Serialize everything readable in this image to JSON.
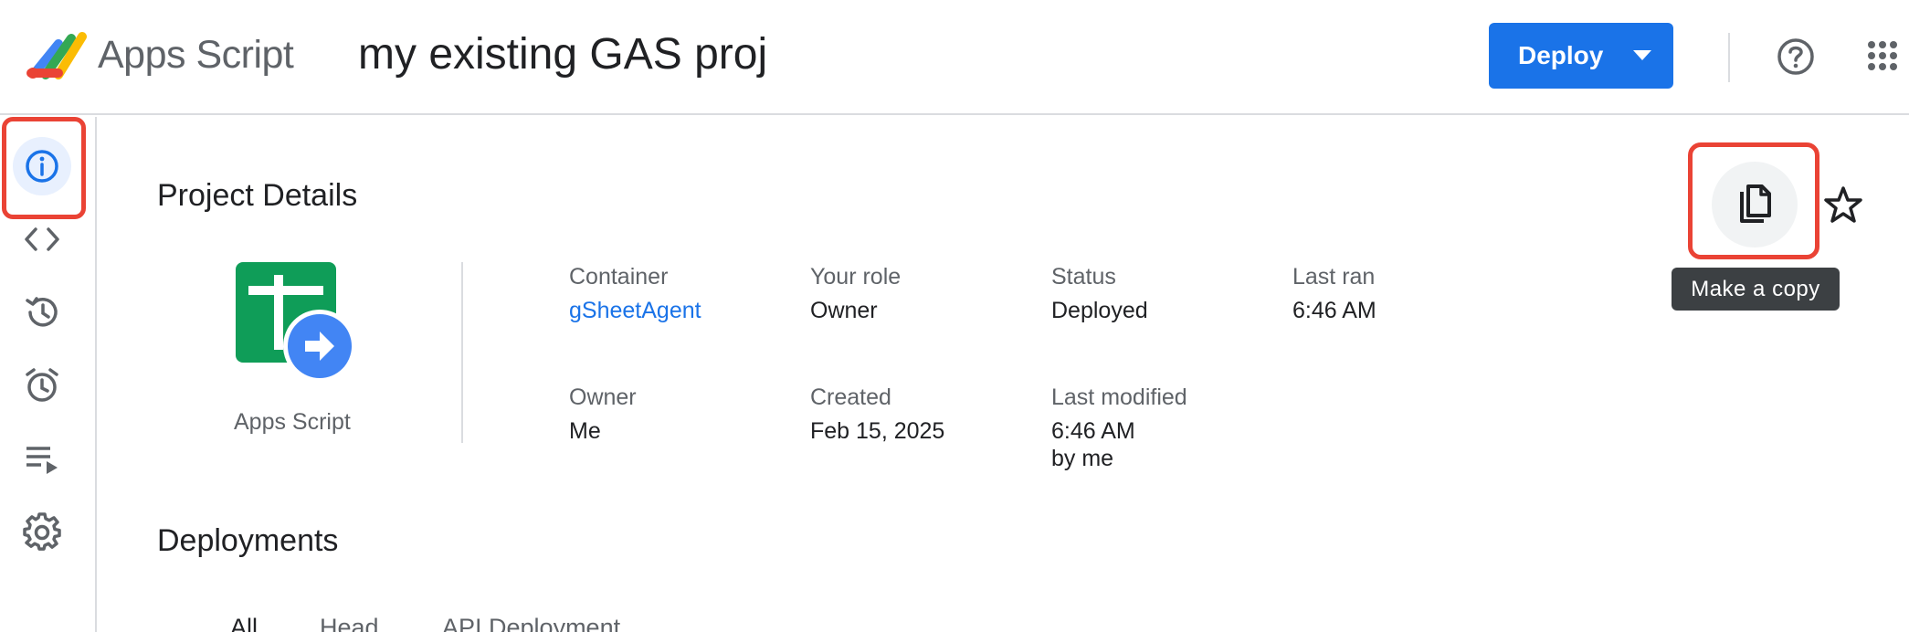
{
  "header": {
    "app_name": "Apps Script",
    "project_title": "my existing GAS proj",
    "deploy_label": "Deploy"
  },
  "sidebar": {
    "items": [
      {
        "name": "overview",
        "icon": "info-icon"
      },
      {
        "name": "editor",
        "icon": "code-icon"
      },
      {
        "name": "history",
        "icon": "history-icon"
      },
      {
        "name": "triggers",
        "icon": "alarm-clock-icon"
      },
      {
        "name": "executions",
        "icon": "executions-list-icon"
      },
      {
        "name": "settings",
        "icon": "gear-icon"
      }
    ]
  },
  "main": {
    "project_details_title": "Project Details",
    "file_caption": "Apps Script",
    "fields": {
      "container_label": "Container",
      "container_value": "gSheetAgent",
      "role_label": "Your role",
      "role_value": "Owner",
      "status_label": "Status",
      "status_value": "Deployed",
      "last_ran_label": "Last ran",
      "last_ran_value": "6:46 AM",
      "owner_label": "Owner",
      "owner_value": "Me",
      "created_label": "Created",
      "created_value": "Feb 15, 2025",
      "last_modified_label": "Last modified",
      "last_modified_value": "6:46 AM",
      "last_modified_by": "by me"
    },
    "tooltip": "Make a copy",
    "deployments_title": "Deployments",
    "tabs": [
      {
        "label": "All",
        "active": true
      },
      {
        "label": "Head",
        "active": false
      },
      {
        "label": "API Deployment",
        "active": false
      }
    ]
  },
  "colors": {
    "accent": "#1a73e8",
    "highlight": "#ea4335",
    "active_bg": "#e8f0fe"
  }
}
